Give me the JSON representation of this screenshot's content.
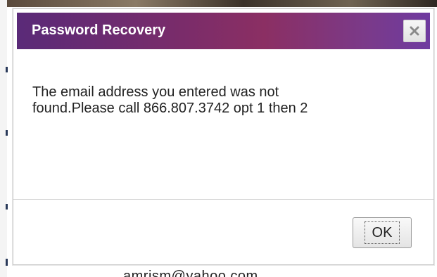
{
  "dialog": {
    "title": "Password Recovery",
    "close_icon": "close-x-icon",
    "message": "The email address you entered was not found.Please call 866.807.3742 opt 1 then 2",
    "ok_label": "OK"
  },
  "background": {
    "partial_text": "amrism@yahoo.com"
  },
  "colors": {
    "title_bar_start": "#5a2a78",
    "title_bar_mid": "#8b2f63",
    "title_bar_end": "#6f3aa0",
    "title_text": "#ffffff"
  }
}
